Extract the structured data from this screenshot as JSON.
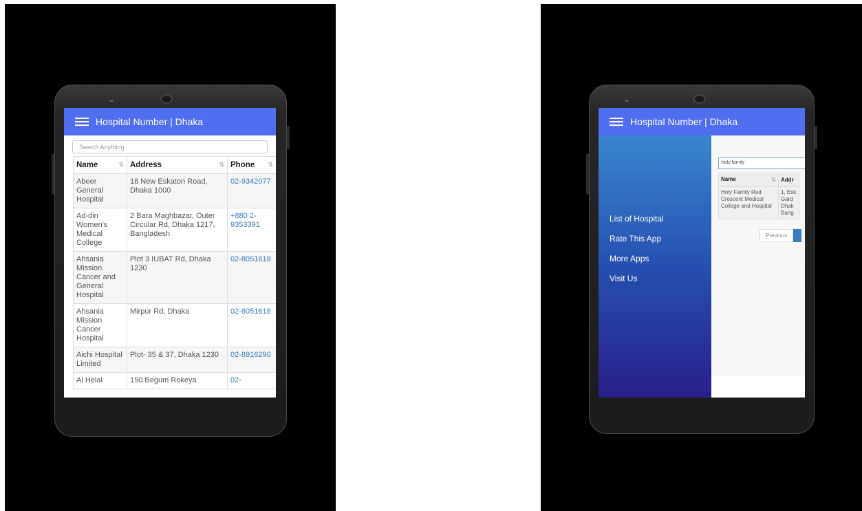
{
  "app": {
    "title": "Hospital Number | Dhaka"
  },
  "left": {
    "search_placeholder": "Search Anything",
    "columns": [
      "Name",
      "Address",
      "Phone"
    ],
    "rows": [
      {
        "name": "Abeer General Hospital",
        "address": "18 New Eskaton Road, Dhaka 1000",
        "phone": "02-9342077"
      },
      {
        "name": "Ad-din Women's Medical College",
        "address": "2 Bara Maghbazar, Outer Circular Rd, Dhaka 1217, Bangladesh",
        "phone": "+880 2-9353391"
      },
      {
        "name": "Ahsania Mission Cancer and General Hospital",
        "address": "Plot 3 IUBAT Rd, Dhaka 1230",
        "phone": "02-8051618"
      },
      {
        "name": "Ahsania Mission Cancer Hospital",
        "address": "Mirpur Rd, Dhaka",
        "phone": "02-8051618"
      },
      {
        "name": "Aichi Hospital Limited",
        "address": "Plot- 35 & 37, Dhaka 1230",
        "phone": "02-8916290"
      },
      {
        "name": "Al Helal",
        "address": "150 Begum Rokeya",
        "phone": "02-"
      }
    ]
  },
  "right": {
    "menu": [
      "List of Hospital",
      "Rate This App",
      "More Apps",
      "Visit Us"
    ],
    "search_value": "holy family",
    "columns": [
      "Name",
      "Addr"
    ],
    "row": {
      "name": "Holy Family Red Crescent Medical College and Hospital",
      "address": "1, Esk Gard Dhak Bang"
    },
    "pager_prev": "Previous"
  },
  "icons": {
    "menu": "hamburger-menu-icon",
    "sort": "sort-icon"
  },
  "colors": {
    "appbar": "#4f6ef0",
    "link": "#3b7bbf",
    "drawer_top": "#3a86cf",
    "drawer_bottom": "#291f8a"
  }
}
